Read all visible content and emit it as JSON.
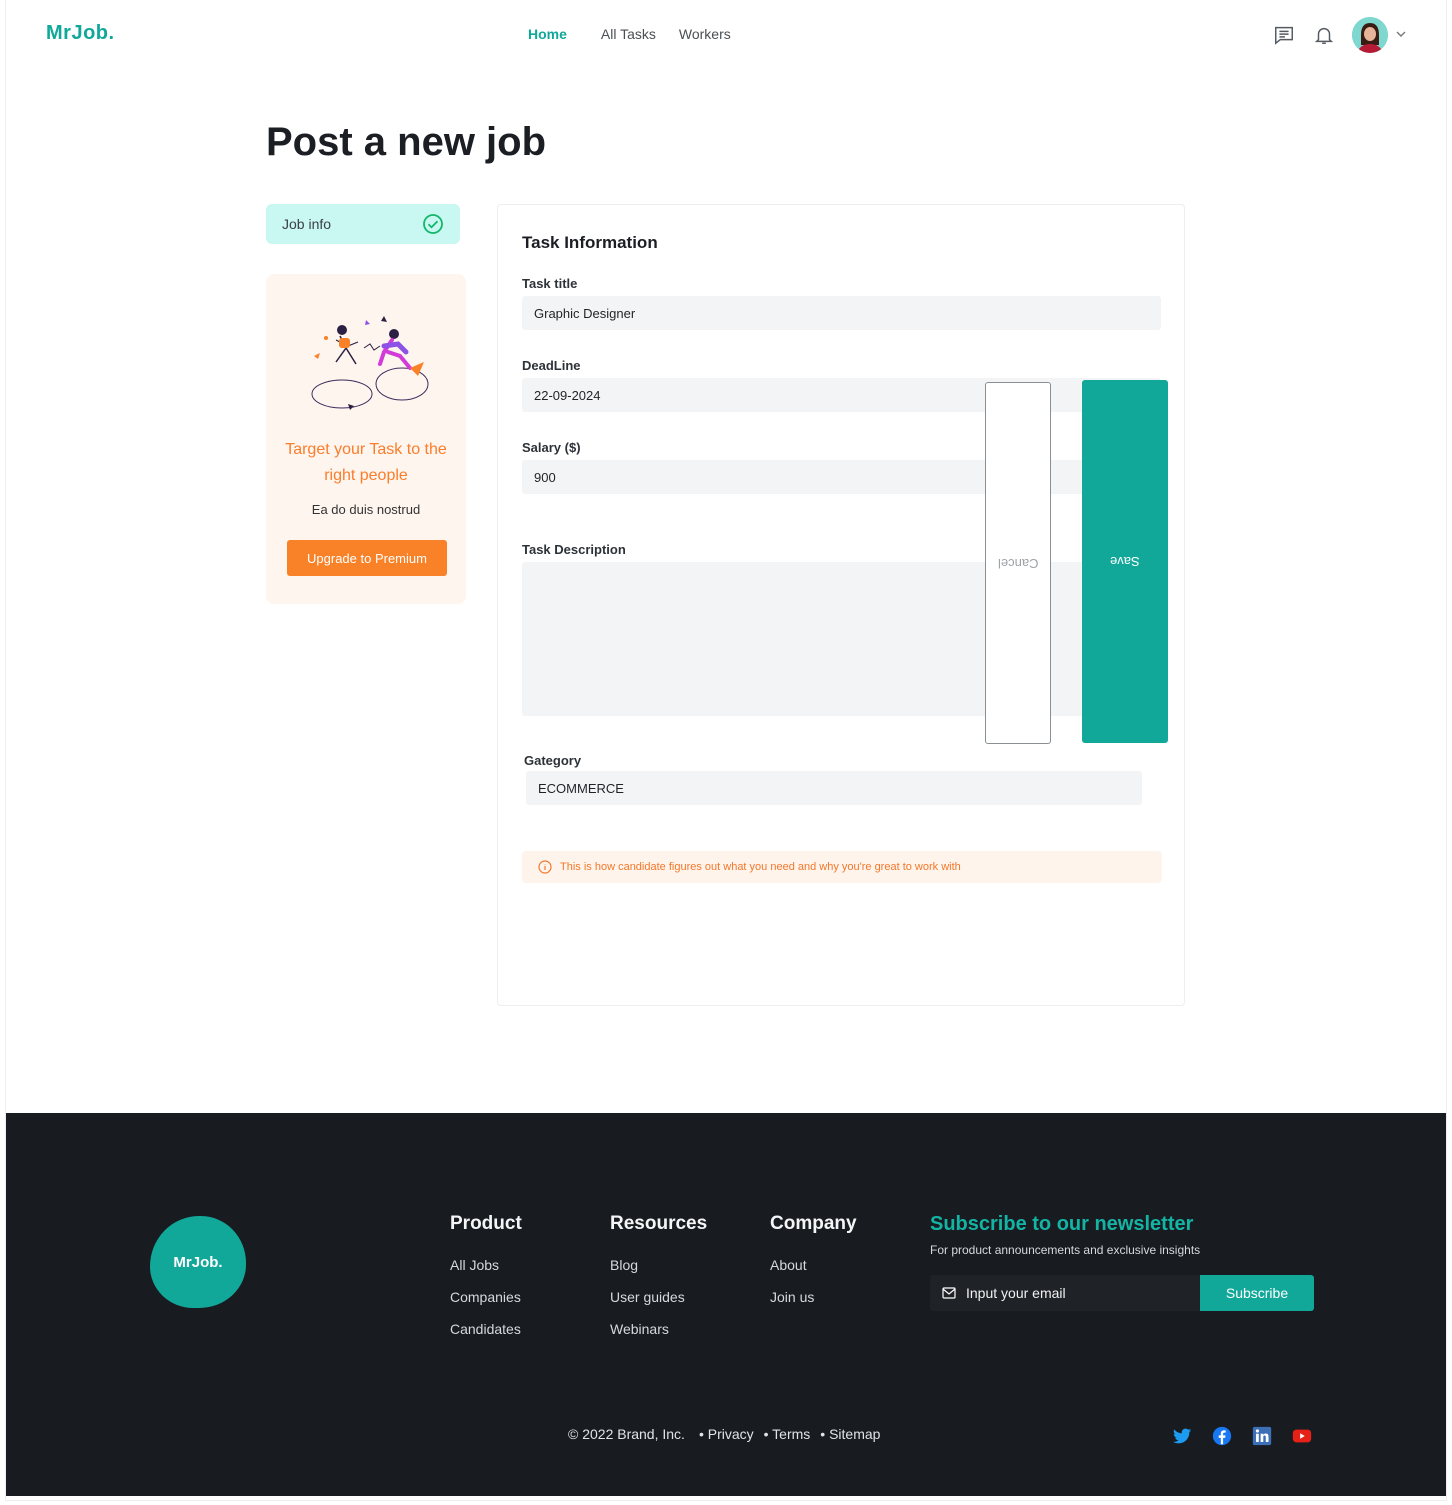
{
  "header": {
    "logo": "MrJob.",
    "nav": [
      {
        "label": "Home",
        "active": true
      },
      {
        "label": "All Tasks",
        "active": false
      },
      {
        "label": "Workers",
        "active": false
      }
    ],
    "icons": [
      "messages-icon",
      "bell-icon",
      "avatar",
      "chevron-down-icon"
    ]
  },
  "page": {
    "title": "Post a new job"
  },
  "sidebar": {
    "tab_label": "Job info",
    "promo": {
      "title": "Target your Task to the right people",
      "subtitle": "Ea do duis nostrud",
      "button": "Upgrade to Premium"
    }
  },
  "form": {
    "title": "Task Information",
    "task_title": {
      "label": "Task title",
      "value": "Graphic Designer"
    },
    "deadline": {
      "label": "DeadLine",
      "value": "22-09-2024"
    },
    "salary": {
      "label": "Salary  ($)",
      "value": "900"
    },
    "description": {
      "label": "Task Description",
      "value": ""
    },
    "category": {
      "label": "Gategory",
      "value": "ECOMMERCE"
    },
    "notice": "This is how candidate figures out what you need and why you're great to work with",
    "cancel_label": "Cancel",
    "save_label": "Save"
  },
  "footer": {
    "logo": "MrJob.",
    "columns": [
      {
        "title": "Product",
        "links": [
          "All Jobs",
          "Companies",
          "Candidates"
        ]
      },
      {
        "title": "Resources",
        "links": [
          "Blog",
          "User guides",
          "Webinars"
        ]
      },
      {
        "title": "Company",
        "links": [
          "About",
          "Join us"
        ]
      }
    ],
    "newsletter": {
      "title": "Subscribe to our newsletter",
      "subtitle": "For product announcements and exclusive insights",
      "placeholder": "Input your email",
      "button": "Subscribe"
    },
    "copyright": "© 2022 Brand, Inc.",
    "legal": [
      "• Privacy",
      "• Terms",
      "• Sitemap"
    ],
    "social": [
      "twitter-icon",
      "facebook-icon",
      "linkedin-icon",
      "youtube-icon"
    ]
  },
  "colors": {
    "brand": "#11a89a",
    "accent_orange": "#f98127",
    "footer_bg": "#181b1f"
  }
}
